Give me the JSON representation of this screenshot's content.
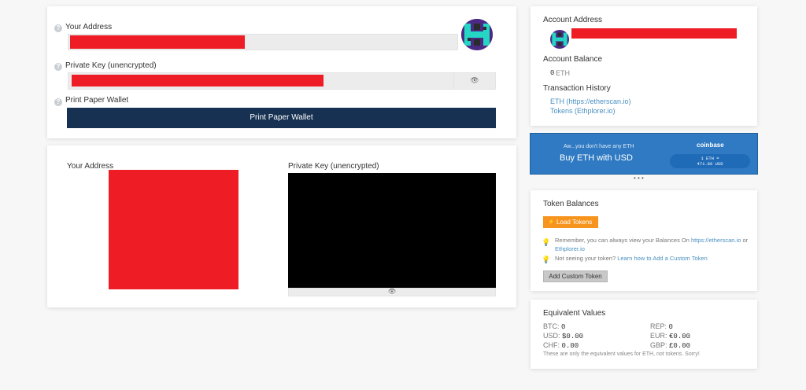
{
  "wallet": {
    "your_address_label": "Your Address",
    "private_key_label": "Private Key (unencrypted)",
    "print_label": "Print Paper Wallet",
    "print_button": "Print Paper Wallet",
    "help_glyph": "?",
    "eye_glyph": "👁"
  },
  "paper": {
    "your_address_label": "Your Address",
    "private_key_label": "Private Key (unencrypted)",
    "eye_glyph": "👁"
  },
  "account": {
    "address_label": "Account Address",
    "balance_label": "Account Balance",
    "balance_value": "0",
    "balance_unit": "ETH",
    "history_label": "Transaction History",
    "history_links": [
      "ETH (https://etherscan.io)",
      "Tokens (Ethplorer.io)"
    ]
  },
  "coinbase": {
    "tagline": "Aw...you don't have any ETH",
    "cta": "Buy ETH with USD",
    "brand": "coinbase",
    "rate_line1": "1 ETH =",
    "rate_line2": "471.86 USD",
    "dots": "• • •",
    "bg_color": "#2f7ac3"
  },
  "tokens": {
    "title": "Token Balances",
    "load_button": "Load Tokens",
    "load_icon": "⚡",
    "tip1_text": "Remember, you can always view your Balances On ",
    "tip1_link1": "https://etherscan.io",
    "tip1_or": " or",
    "tip1_link2": "Ethplorer.io",
    "tip2_text": "Not seeing your token? ",
    "tip2_link": "Learn how to Add a Custom Token",
    "add_custom_button": "Add Custom Token",
    "bulb_icon": "💡",
    "accent_color": "#f7941d"
  },
  "equivalent": {
    "title": "Equivalent Values",
    "rows": [
      {
        "k": "BTC:",
        "v": "0"
      },
      {
        "k": "USD:",
        "v": "$0.00"
      },
      {
        "k": "CHF:",
        "v": "0.00"
      },
      {
        "k": "REP:",
        "v": "0"
      },
      {
        "k": "EUR:",
        "v": "€0.00"
      },
      {
        "k": "GBP:",
        "v": "£0.00"
      }
    ],
    "note": "These are only the equivalent values for ETH, not tokens. Sorry!"
  }
}
